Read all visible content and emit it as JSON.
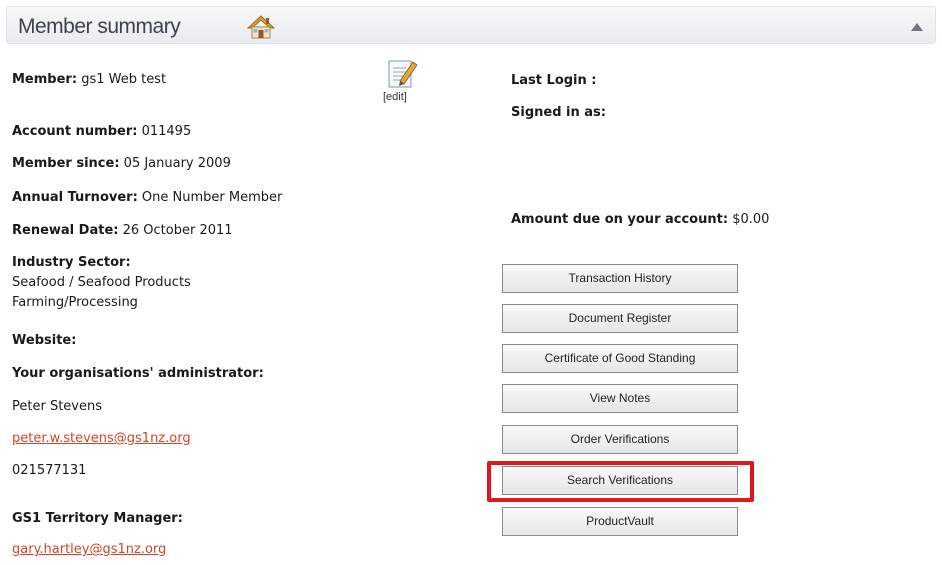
{
  "header": {
    "title": "Member summary"
  },
  "member": {
    "member_label": "Member:",
    "member_value": "gs1 Web test",
    "edit_label": "[edit]",
    "account_label": "Account number:",
    "account_value": "011495",
    "since_label": "Member since:",
    "since_value": "05 January 2009",
    "turnover_label": "Annual Turnover:",
    "turnover_value": "One Number Member",
    "renewal_label": "Renewal Date:",
    "renewal_value": "26 October 2011",
    "sector_label": "Industry Sector:",
    "sector_line1": "Seafood / Seafood Products",
    "sector_line2": "Farming/Processing",
    "website_label": "Website:",
    "admin_label": "Your organisations' administrator:",
    "admin_name": "Peter Stevens",
    "admin_email": "peter.w.stevens@gs1nz.org",
    "admin_phone": "021577131",
    "manager_label": "GS1 Territory Manager:",
    "manager_email": "gary.hartley@gs1nz.org"
  },
  "session": {
    "last_login_label": "Last Login :",
    "signed_in_label": "Signed in as:",
    "amount_due_label": "Amount due on your account:",
    "amount_due_value": "$0.00"
  },
  "buttons": [
    "Transaction History",
    "Document Register",
    "Certificate of Good Standing",
    "View Notes",
    "Order Verifications",
    "Search Verifications",
    "ProductVault"
  ],
  "colors": {
    "link": "#d0452a",
    "highlight": "#e0181c"
  },
  "icons": {
    "home": "home-icon",
    "edit": "edit-icon",
    "collapse": "collapse-up-icon"
  }
}
